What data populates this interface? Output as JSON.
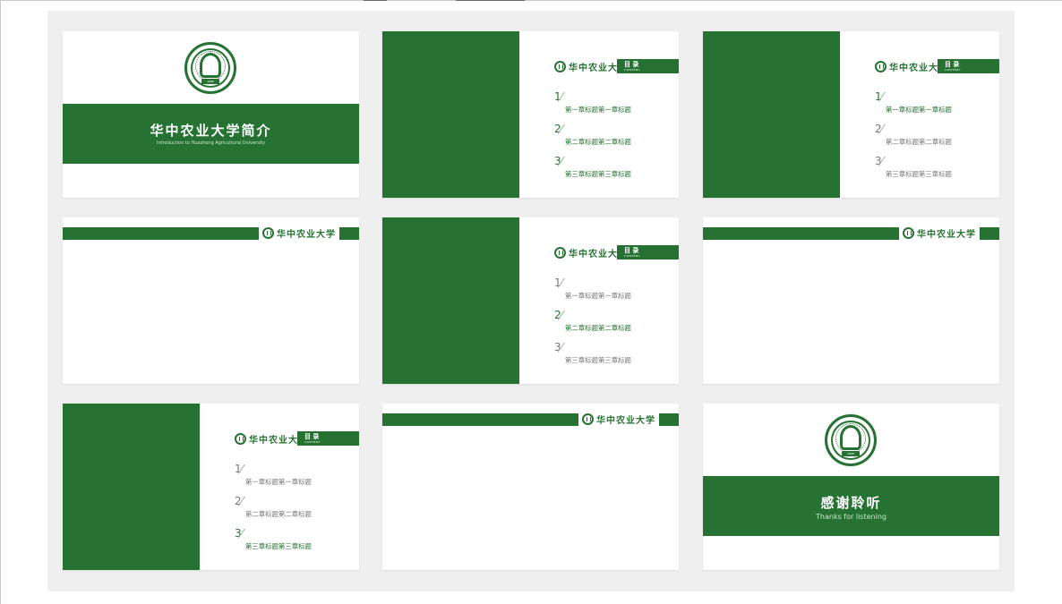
{
  "colors": {
    "brand_green": "#267232",
    "canvas_gray": "#efefef"
  },
  "slides": {
    "cover": {
      "seal_icon": "university-seal-icon",
      "seal_text": "1898",
      "title": "华中农业大学简介",
      "subtitle": "Introduction to Huazhong Agricultural University"
    },
    "toc1": {
      "logo_text": "华中农业大学",
      "mulu_title": "目 录",
      "mulu_sub": "CONTENT",
      "items": [
        {
          "num": "1",
          "label": "第一章标题第一章标题"
        },
        {
          "num": "2",
          "label": "第二章标题第二章标题"
        },
        {
          "num": "3",
          "label": "第三章标题第三章标题"
        }
      ]
    },
    "toc2": {
      "logo_text": "华中农业大学",
      "mulu_title": "目 录",
      "mulu_sub": "CONTENT",
      "items": [
        {
          "num": "1",
          "label": "第一章标题第一章标题"
        },
        {
          "num": "2",
          "label": "第二章标题第二章标题"
        },
        {
          "num": "3",
          "label": "第三章标题第三章标题"
        }
      ]
    },
    "content1": {
      "logo_text": "华中农业大学"
    },
    "toc3": {
      "logo_text": "华中农业大学",
      "mulu_title": "目 录",
      "mulu_sub": "CONTENT",
      "items": [
        {
          "num": "1",
          "label": "第一章标题第一章标题"
        },
        {
          "num": "2",
          "label": "第二章标题第二章标题"
        },
        {
          "num": "3",
          "label": "第三章标题第三章标题"
        }
      ]
    },
    "content2": {
      "logo_text": "华中农业大学"
    },
    "toc4": {
      "logo_text": "华中农业大学",
      "mulu_title": "目 录",
      "mulu_sub": "CONTENT",
      "items": [
        {
          "num": "1",
          "label": "第一章标题第一章标题"
        },
        {
          "num": "2",
          "label": "第二章标题第二章标题"
        },
        {
          "num": "3",
          "label": "第三章标题第三章标题"
        }
      ]
    },
    "content3": {
      "logo_text": "华中农业大学"
    },
    "end": {
      "seal_icon": "university-seal-icon",
      "seal_text": "1898",
      "title": "感谢聆听",
      "subtitle": "Thanks for listening"
    }
  }
}
